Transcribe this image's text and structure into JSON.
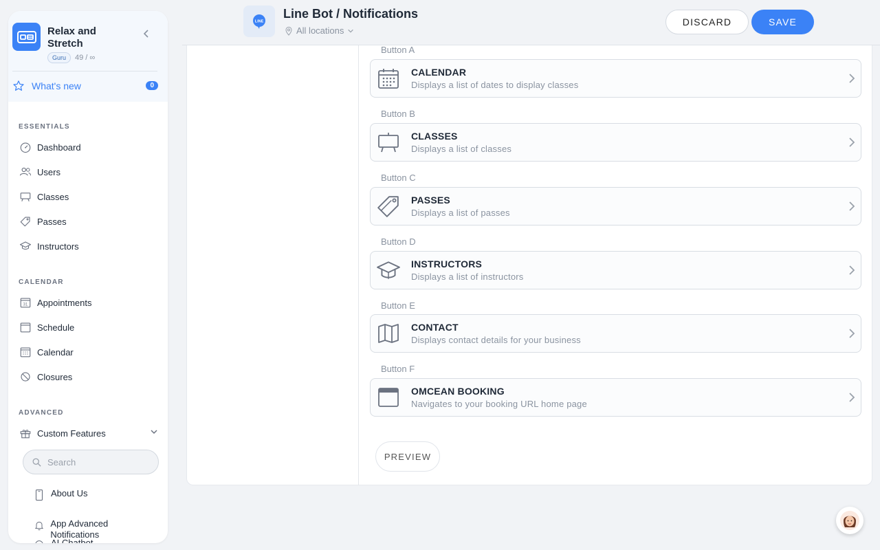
{
  "sidebar": {
    "brand": {
      "name": "Relax and Stretch",
      "plan_badge": "Guru",
      "plan_count": "49 / ∞"
    },
    "whats_new": {
      "label": "What's new",
      "count": "0"
    },
    "sections": {
      "essentials": "ESSENTIALS",
      "calendar": "CALENDAR",
      "advanced": "ADVANCED"
    },
    "essentials_items": [
      {
        "label": "Dashboard",
        "icon": "dashboard-icon"
      },
      {
        "label": "Users",
        "icon": "users-icon"
      },
      {
        "label": "Classes",
        "icon": "easel-icon"
      },
      {
        "label": "Passes",
        "icon": "tag-icon"
      },
      {
        "label": "Instructors",
        "icon": "graduation-cap-icon"
      }
    ],
    "calendar_items": [
      {
        "label": "Appointments",
        "icon": "calendar-31-icon"
      },
      {
        "label": "Schedule",
        "icon": "calendar-icon"
      },
      {
        "label": "Calendar",
        "icon": "calendar-grid-icon"
      },
      {
        "label": "Closures",
        "icon": "ban-icon"
      }
    ],
    "advanced_items": [
      {
        "label": "Custom Features",
        "icon": "gift-icon"
      }
    ],
    "search": {
      "placeholder": "Search",
      "value": ""
    },
    "sub_items": [
      {
        "label": "About Us",
        "icon": "phone-icon"
      },
      {
        "label": "App Advanced Notifications",
        "icon": "bell-icon"
      },
      {
        "label": "AI Chatbot",
        "icon": "chat-icon"
      }
    ]
  },
  "header": {
    "title": "Line Bot / Notifications",
    "location": "All locations",
    "discard_label": "DISCARD",
    "save_label": "SAVE",
    "line_icon_text": "LINE"
  },
  "buttons": [
    {
      "group": "Button A",
      "title": "CALENDAR",
      "desc": "Displays a list of dates to display classes",
      "icon": "calendar-grid-icon"
    },
    {
      "group": "Button B",
      "title": "CLASSES",
      "desc": "Displays a list of classes",
      "icon": "easel-icon"
    },
    {
      "group": "Button C",
      "title": "PASSES",
      "desc": "Displays a list of passes",
      "icon": "tag-icon"
    },
    {
      "group": "Button D",
      "title": "INSTRUCTORS",
      "desc": "Displays a list of instructors",
      "icon": "graduation-cap-icon"
    },
    {
      "group": "Button E",
      "title": "CONTACT",
      "desc": "Displays contact details for your business",
      "icon": "map-icon"
    },
    {
      "group": "Button F",
      "title": "OMCEAN BOOKING",
      "desc": "Navigates to your booking URL home page",
      "icon": "browser-window-icon"
    }
  ],
  "preview_label": "PREVIEW",
  "colors": {
    "accent": "#3b82f6",
    "background": "#f1f3f6"
  }
}
